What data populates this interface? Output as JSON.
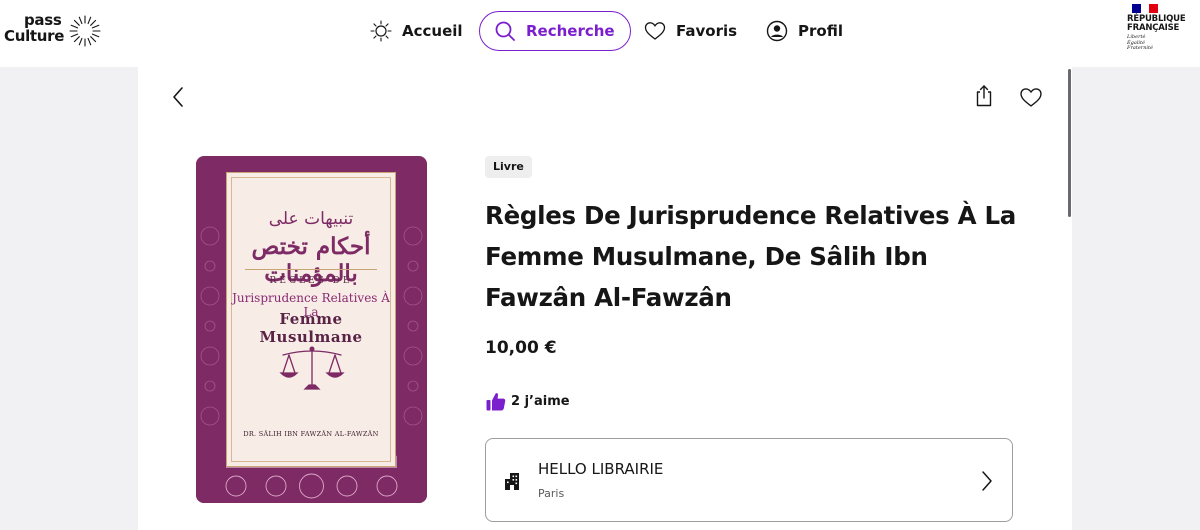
{
  "header": {
    "logo_line1": "pass",
    "logo_line2": "Culture",
    "nav": [
      {
        "label": "Accueil",
        "icon": "sun-icon",
        "active": false
      },
      {
        "label": "Recherche",
        "icon": "search-icon",
        "active": true
      },
      {
        "label": "Favoris",
        "icon": "heart-icon",
        "active": false
      },
      {
        "label": "Profil",
        "icon": "user-icon",
        "active": false
      }
    ],
    "republique": {
      "line1": "RÉPUBLIQUE",
      "line2": "FRANÇAISE",
      "motto1": "Liberté",
      "motto2": "Égalité",
      "motto3": "Fraternité"
    }
  },
  "colors": {
    "accent": "#7b1fce",
    "cover_purple": "#7d2a65"
  },
  "offer": {
    "category": "Livre",
    "title": "Règles De Jurisprudence Relatives À La Femme Musulmane, De Sâlih Ibn Fawzân Al-Fawzân",
    "price": "10,00 €",
    "likes": "2 j’aime",
    "cover": {
      "ar_line1": "تنبيهات على",
      "ar_line2": "أحكام تختص بالمؤمنات",
      "fr_line1": "RÈGLES DE",
      "fr_line2": "Jurisprudence Relatives À La",
      "fr_line3": "Femme Musulmane",
      "author": "DR. SÂLIH IBN FAWZÂN AL-FAWZÂN"
    },
    "venue": {
      "name": "HELLO LIBRAIRIE",
      "city": "Paris"
    }
  }
}
